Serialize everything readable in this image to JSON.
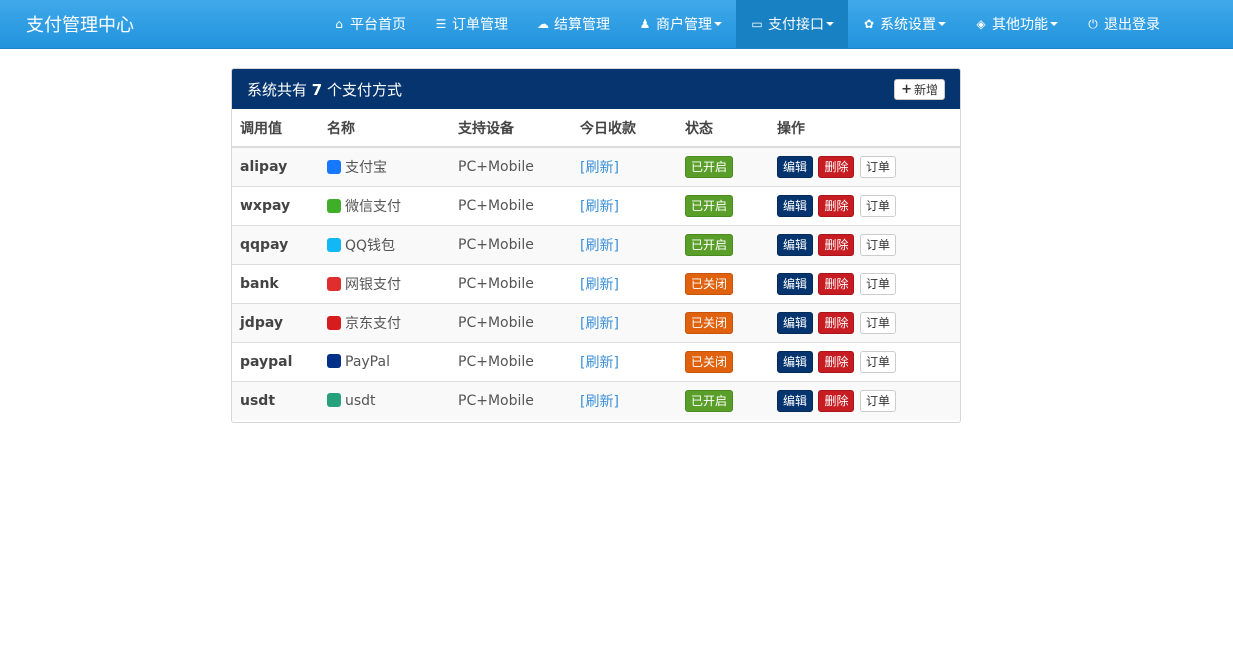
{
  "navbar": {
    "brand": "支付管理中心",
    "items": [
      {
        "label": "平台首页",
        "icon": "home-icon",
        "glyph": "⌂",
        "dropdown": false,
        "active": false
      },
      {
        "label": "订单管理",
        "icon": "list-icon",
        "glyph": "☰",
        "dropdown": false,
        "active": false
      },
      {
        "label": "结算管理",
        "icon": "cloud-icon",
        "glyph": "☁",
        "dropdown": false,
        "active": false
      },
      {
        "label": "商户管理",
        "icon": "user-icon",
        "glyph": "♟",
        "dropdown": true,
        "active": false
      },
      {
        "label": "支付接口",
        "icon": "credit-card-icon",
        "glyph": "▭",
        "dropdown": true,
        "active": true
      },
      {
        "label": "系统设置",
        "icon": "gear-icon",
        "glyph": "✿",
        "dropdown": true,
        "active": false
      },
      {
        "label": "其他功能",
        "icon": "cube-icon",
        "glyph": "◈",
        "dropdown": true,
        "active": false
      },
      {
        "label": "退出登录",
        "icon": "power-icon",
        "glyph": "⏻",
        "dropdown": false,
        "active": false
      }
    ]
  },
  "panel": {
    "title_prefix": "系统共有",
    "count": "7",
    "title_suffix": "个支付方式",
    "add_label": "新增",
    "add_glyph": "+"
  },
  "table": {
    "headers": [
      "调用值",
      "名称",
      "支持设备",
      "今日收款",
      "状态",
      "操作"
    ],
    "rows": [
      {
        "code": "alipay",
        "name": "支付宝",
        "icon": "alipay-icon",
        "icon_color": "#1677ff",
        "device": "PC+Mobile",
        "income": "[刷新]",
        "status": "已开启",
        "enabled": true
      },
      {
        "code": "wxpay",
        "name": "微信支付",
        "icon": "wechat-pay-icon",
        "icon_color": "#3fae29",
        "device": "PC+Mobile",
        "income": "[刷新]",
        "status": "已开启",
        "enabled": true
      },
      {
        "code": "qqpay",
        "name": "QQ钱包",
        "icon": "qq-wallet-icon",
        "icon_color": "#12b7f5",
        "device": "PC+Mobile",
        "income": "[刷新]",
        "status": "已开启",
        "enabled": true
      },
      {
        "code": "bank",
        "name": "网银支付",
        "icon": "unionpay-icon",
        "icon_color": "#e02e2e",
        "device": "PC+Mobile",
        "income": "[刷新]",
        "status": "已关闭",
        "enabled": false
      },
      {
        "code": "jdpay",
        "name": "京东支付",
        "icon": "jd-icon",
        "icon_color": "#d71c1e",
        "device": "PC+Mobile",
        "income": "[刷新]",
        "status": "已关闭",
        "enabled": false
      },
      {
        "code": "paypal",
        "name": "PayPal",
        "icon": "paypal-icon",
        "icon_color": "#003087",
        "device": "PC+Mobile",
        "income": "[刷新]",
        "status": "已关闭",
        "enabled": false
      },
      {
        "code": "usdt",
        "name": "usdt",
        "icon": "tether-icon",
        "icon_color": "#26a17b",
        "device": "PC+Mobile",
        "income": "[刷新]",
        "status": "已开启",
        "enabled": true
      }
    ],
    "actions": {
      "edit": "编辑",
      "delete": "删除",
      "orders": "订单"
    }
  },
  "colors": {
    "navbar": "#2a9be3",
    "panel_heading": "#05346e",
    "enabled": "#5a9e2a",
    "disabled": "#e0620f",
    "delete": "#c71c22"
  }
}
